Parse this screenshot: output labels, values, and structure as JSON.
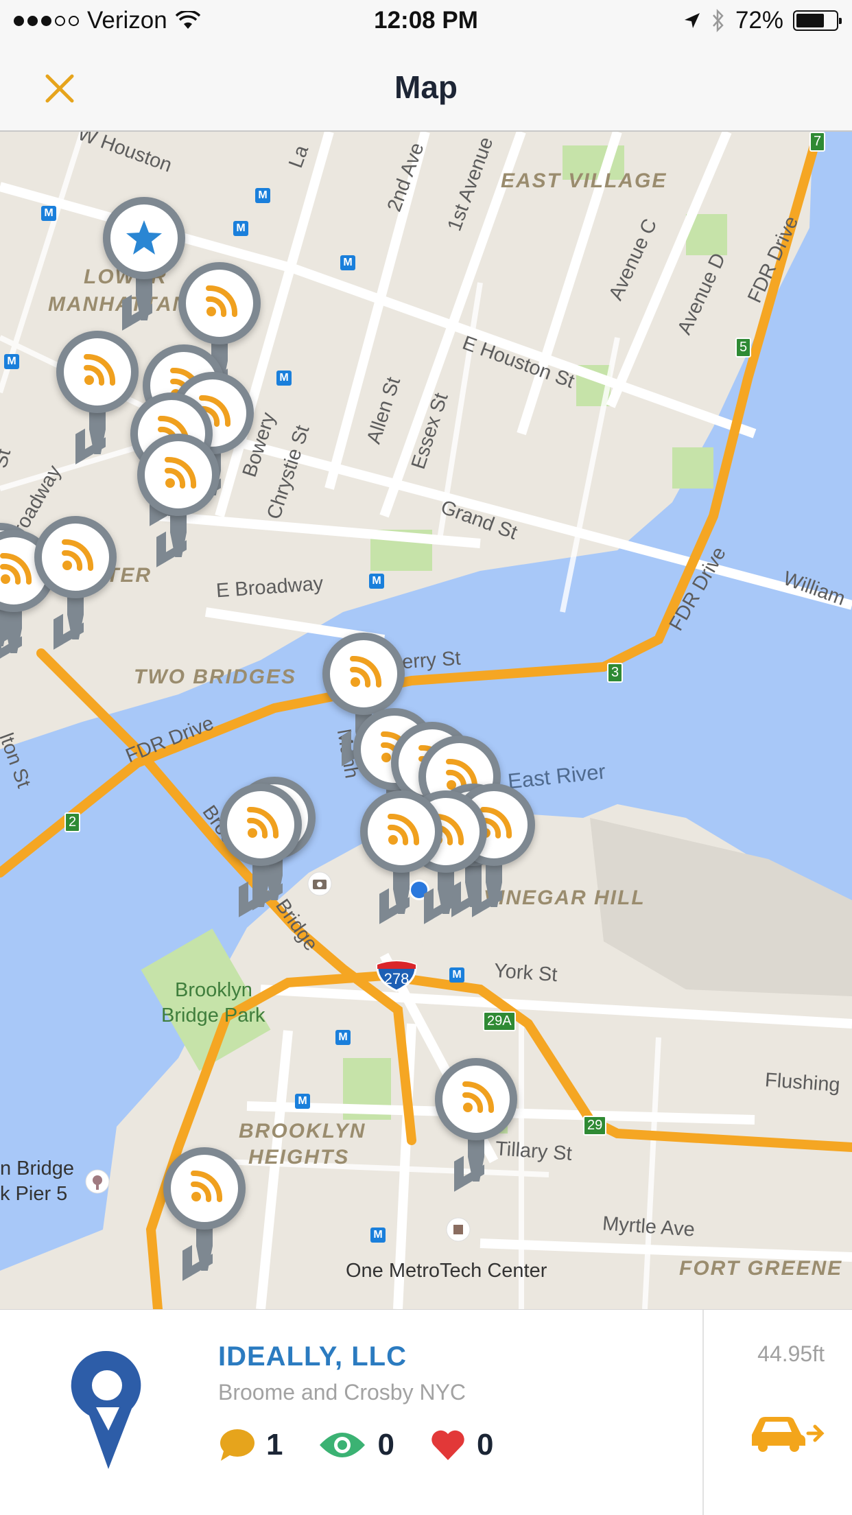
{
  "status_bar": {
    "carrier": "Verizon",
    "time": "12:08 PM",
    "battery": "72%",
    "battery_level": 0.72,
    "icons": [
      "signal-dots",
      "wifi-icon",
      "location-arrow-icon",
      "bluetooth-icon",
      "battery-icon"
    ]
  },
  "nav": {
    "title": "Map",
    "close_icon": "close-icon",
    "accent_color": "#e6a41c"
  },
  "map": {
    "streets": [
      "W Houston",
      "La",
      "2nd Ave",
      "1st Avenue",
      "Avenue C",
      "Avenue D",
      "E Houston St",
      "FDR Drive",
      "Allen St",
      "Essex St",
      "Bowery",
      "Chrystie St",
      "roadway",
      "Grand St",
      "E Broadway",
      "William",
      "herry St",
      "FDR Drive",
      "FDR Drive",
      "Manh",
      "Brook",
      "Bridge",
      "York St",
      "Flushing",
      "Tillary St",
      "Myrtle Ave",
      "lton St",
      "St"
    ],
    "neighborhoods": [
      "EAST VILLAGE",
      "LOWER",
      "MANHATTAN",
      "TER",
      "TWO BRIDGES",
      "VINEGAR HILL",
      "BROOKLYN",
      "HEIGHTS",
      "FORT GREENE"
    ],
    "water": [
      "East River"
    ],
    "parks": [
      "Brooklyn",
      "Bridge Park"
    ],
    "pois": [
      "One MetroTech Center",
      "n Bridge",
      "k Pier 5"
    ],
    "shields": [
      "7",
      "5",
      "3",
      "2",
      "29A",
      "29"
    ],
    "interstate": "278",
    "pin_icon_types": [
      "star-pin-icon",
      "wifi-signal-pin-icon"
    ],
    "colors": {
      "land": "#ebe7df",
      "water": "#a8c8f8",
      "park": "#c6e3a9",
      "highway": "#f5a623",
      "pin_ring": "#7e8891",
      "pin_symbol": "#f0a01e",
      "star": "#2a86d3"
    }
  },
  "card": {
    "name": "IDEALLY, LLC",
    "address": "Broome and Crosby NYC",
    "comments_count": "1",
    "views_count": "0",
    "likes_count": "0",
    "distance": "44.95ft",
    "icons": [
      "location-logo-icon",
      "comment-icon",
      "eye-icon",
      "heart-icon",
      "car-arrow-icon"
    ],
    "colors": {
      "name": "#2b7bc0",
      "comment": "#e6a41c",
      "eye": "#3bb273",
      "heart": "#e23838",
      "car": "#f3a51b"
    }
  }
}
